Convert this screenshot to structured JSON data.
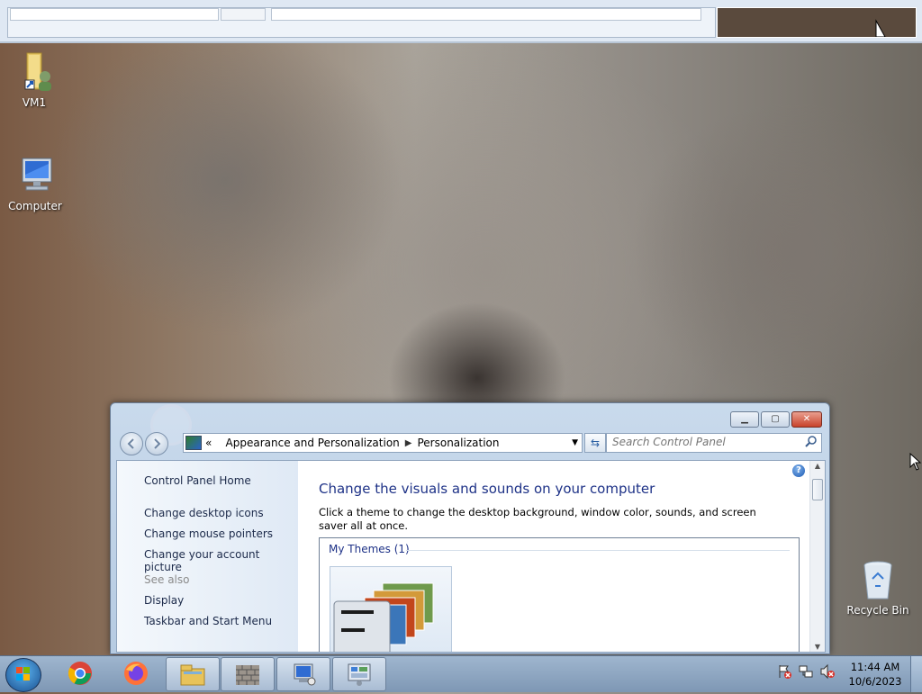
{
  "desktop": {
    "icons": [
      {
        "label": "VM1",
        "icon": "user-folder-shortcut-icon"
      },
      {
        "label": "Computer",
        "icon": "computer-icon"
      },
      {
        "label": "Recycle Bin",
        "icon": "recycle-bin-icon"
      }
    ]
  },
  "control_panel": {
    "breadcrumb": {
      "overflow": "«",
      "items": [
        "Appearance and Personalization",
        "Personalization"
      ]
    },
    "search_placeholder": "Search Control Panel",
    "help_label": "?",
    "left_pane": {
      "home": "Control Panel Home",
      "links": [
        "Change desktop icons",
        "Change mouse pointers",
        "Change your account picture"
      ],
      "see_also_label": "See also",
      "see_also": [
        "Display",
        "Taskbar and Start Menu"
      ]
    },
    "main": {
      "heading": "Change the visuals and sounds on your computer",
      "description": "Click a theme to change the desktop background, window color, sounds, and screen saver all at once.",
      "group_header": "My Themes (1)"
    }
  },
  "taskbar": {
    "items": [
      {
        "icon": "chrome-icon",
        "running": false
      },
      {
        "icon": "firefox-icon",
        "running": false
      },
      {
        "icon": "file-explorer-icon",
        "running": true
      },
      {
        "icon": "brick-wall-icon",
        "running": true
      },
      {
        "icon": "remote-desktop-icon",
        "running": true
      },
      {
        "icon": "control-panel-icon",
        "running": true
      }
    ],
    "tray_icons": [
      "action-center-flag-icon",
      "network-icon",
      "volume-muted-icon"
    ],
    "clock": {
      "time": "11:44 AM",
      "date": "10/6/2023"
    }
  }
}
